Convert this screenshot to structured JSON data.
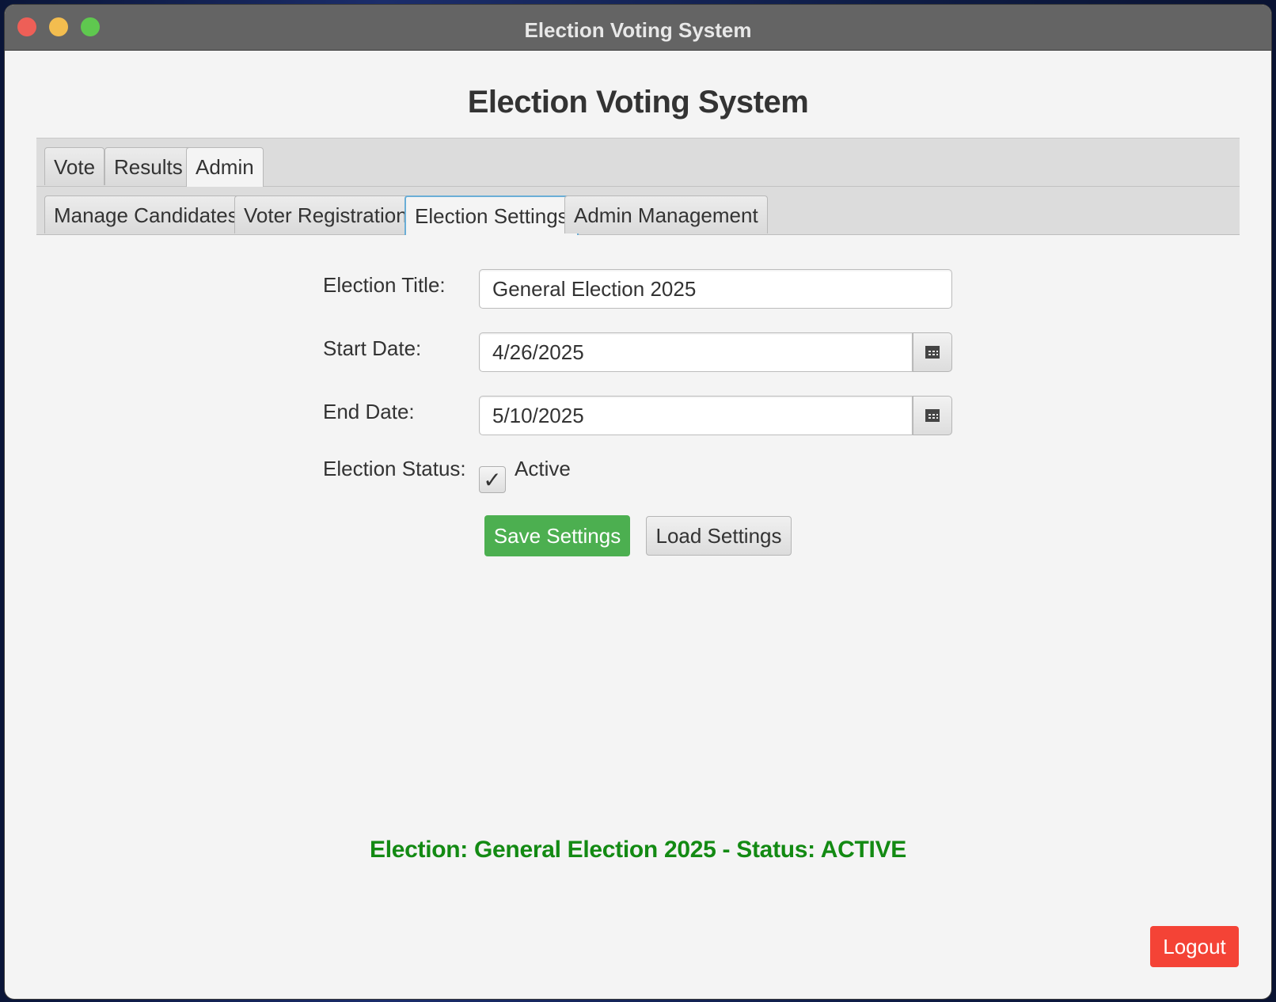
{
  "window": {
    "title": "Election Voting System"
  },
  "app": {
    "title": "Election Voting System"
  },
  "tabs": [
    {
      "label": "Vote"
    },
    {
      "label": "Results"
    },
    {
      "label": "Admin",
      "selected": true
    }
  ],
  "admin_tabs": [
    {
      "label": "Manage Candidates"
    },
    {
      "label": "Voter Registration"
    },
    {
      "label": "Election Settings",
      "selected": true
    },
    {
      "label": "Admin Management"
    }
  ],
  "form": {
    "title_label": "Election Title:",
    "title_value": "General Election 2025",
    "start_label": "Start Date:",
    "start_value": "4/26/2025",
    "end_label": "End Date:",
    "end_value": "5/10/2025",
    "status_label": "Election Status:",
    "active_label": "Active",
    "active_checked": true,
    "check_glyph": "✓",
    "save_label": "Save Settings",
    "load_label": "Load Settings"
  },
  "status_message": "Election: General Election 2025 - Status: ACTIVE",
  "logout_label": "Logout",
  "icons": {
    "calendar": "calendar-icon",
    "checkmark": "checkmark-icon"
  },
  "colors": {
    "save_button": "#4caf50",
    "logout_button": "#f44336",
    "status_text": "#138a13",
    "title_bar": "#646464",
    "active_tab_border": "#6aaed6"
  }
}
